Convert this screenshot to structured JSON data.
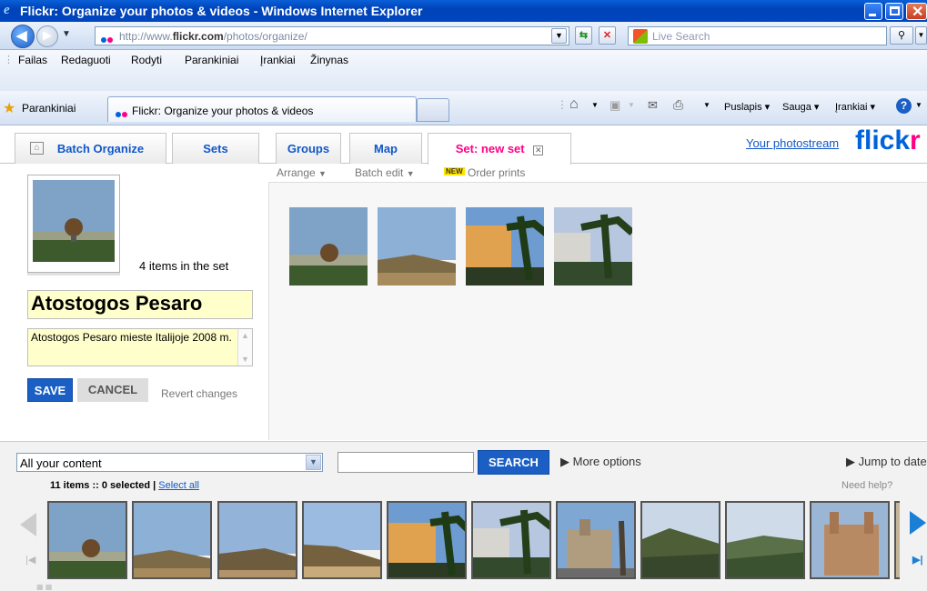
{
  "window": {
    "title": "Flickr: Organize your photos & videos - Windows Internet Explorer"
  },
  "address": {
    "url_prefix": "http://www.",
    "url_domain": "flickr.com",
    "url_path": "/photos/organize/"
  },
  "search_box": {
    "placeholder": "Live Search"
  },
  "menu": {
    "items": [
      "Failas",
      "Redaguoti",
      "Rodyti",
      "Parankiniai",
      "Įrankiai",
      "Žinynas"
    ]
  },
  "favorites": {
    "label": "Parankiniai",
    "tab_title": "Flickr: Organize your photos & videos"
  },
  "commandbar": {
    "page": "Puslapis",
    "safety": "Sauga",
    "tools": "Įrankiai"
  },
  "flickr": {
    "tabs": [
      "Batch Organize",
      "Sets",
      "Groups",
      "Map",
      "Set: new set"
    ],
    "photostream_link": "Your photostream",
    "logo_part1": "flick",
    "logo_part2": "r",
    "toolbar": {
      "arrange": "Arrange",
      "batch_edit": "Batch edit",
      "new_badge": "NEW",
      "order_prints": "Order prints"
    },
    "set": {
      "items_count": "4 items in the set",
      "title": "Atostogos Pesaro",
      "description": "Atostogos Pesaro mieste Italijoje 2008 m."
    },
    "buttons": {
      "save": "SAVE",
      "cancel": "CANCEL",
      "revert": "Revert changes"
    },
    "bottom": {
      "content_select": "All your content",
      "search_button": "SEARCH",
      "more_options": "▶ More options",
      "jump_to_date": "▶ Jump to date",
      "items_prefix": "11 items :: 0 selected | ",
      "select_all": "Select all",
      "need_help": "Need help?"
    }
  },
  "colors": {
    "flickr_blue": "#0063dc",
    "flickr_pink": "#ff0084",
    "button_blue": "#1b5fc4"
  }
}
